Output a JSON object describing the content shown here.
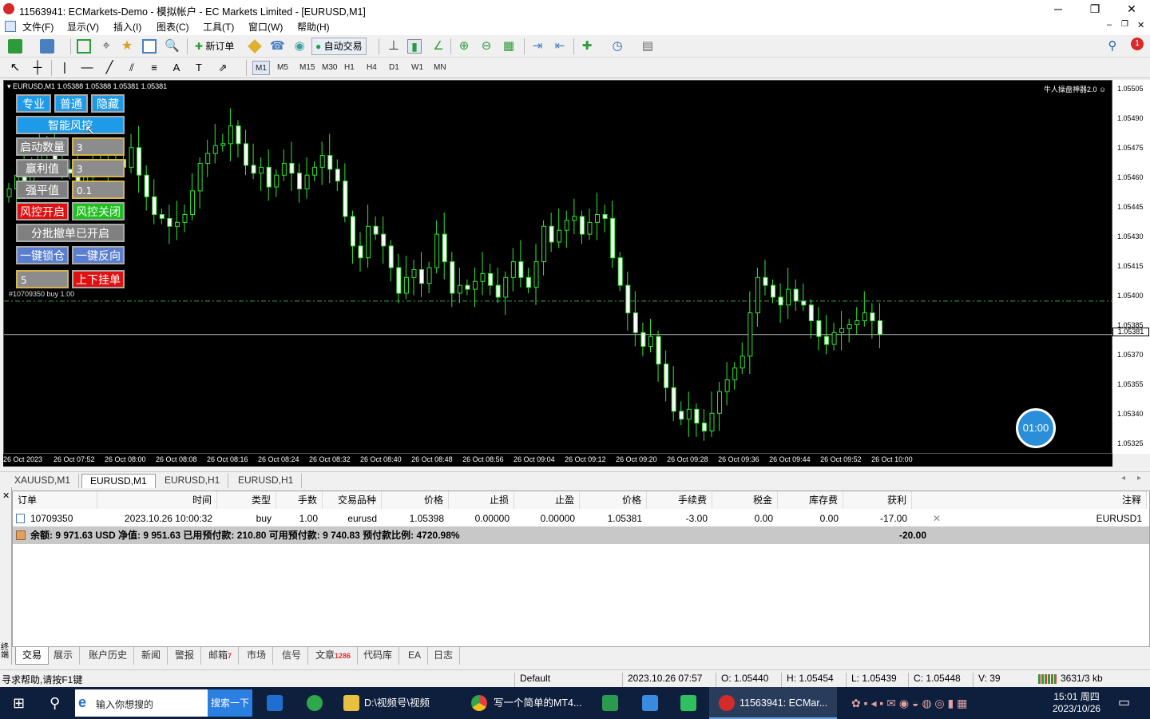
{
  "window": {
    "title": "11563941: ECMarkets-Demo - 模拟帐户 - EC Markets Limited - [EURUSD,M1]",
    "min": "─",
    "max": "❐",
    "close": "✕"
  },
  "menu": [
    "文件(F)",
    "显示(V)",
    "插入(I)",
    "图表(C)",
    "工具(T)",
    "窗口(W)",
    "帮助(H)"
  ],
  "toolbar": {
    "new_order": "新订单",
    "auto_trading": "自动交易",
    "notification_count": "1"
  },
  "timeframes": [
    "M1",
    "M5",
    "M15",
    "M30",
    "H1",
    "H4",
    "D1",
    "W1",
    "MN"
  ],
  "active_timeframe": "M1",
  "chart": {
    "header": "EURUSD,M1  1.05388 1.05388 1.05381 1.05381",
    "ea_name": "牛人操盘神器2.0",
    "order_line_label": "#10709350 buy 1.00",
    "timer": "01:00",
    "current_price": "1.05381"
  },
  "ea_panel": {
    "pro": "专业",
    "normal": "普通",
    "hide": "隐藏",
    "smart_risk": "智能风控",
    "start_count_label": "启动数量",
    "start_count_value": "3",
    "profit_label": "赢利值",
    "profit_value": "3",
    "force_close_label": "强平值",
    "force_close_value": "0.1",
    "risk_on": "风控开启",
    "risk_off": "风控关闭",
    "batch_cancel": "分批撤单已开启",
    "lock": "一键锁仓",
    "reverse": "一键反向",
    "pending_value": "5",
    "pending_button": "上下挂单"
  },
  "chart_tabs": [
    "XAUUSD,M1",
    "EURUSD,M1",
    "EURUSD,H1",
    "EURUSD,H1"
  ],
  "active_chart_tab": "EURUSD,M1",
  "terminal": {
    "columns": [
      "订单",
      "时间",
      "类型",
      "手数",
      "交易品种",
      "价格",
      "止损",
      "止盈",
      "价格",
      "手续费",
      "税金",
      "库存费",
      "获利",
      "注释"
    ],
    "rows": [
      {
        "order": "10709350",
        "time": "2023.10.26 10:00:32",
        "type": "buy",
        "lots": "1.00",
        "symbol": "eurusd",
        "open_price": "1.05398",
        "sl": "0.00000",
        "tp": "0.00000",
        "price": "1.05381",
        "commission": "-3.00",
        "tax": "0.00",
        "swap": "0.00",
        "profit": "-17.00",
        "comment": "EURUSD1"
      }
    ],
    "summary": "余额: 9 971.63 USD  净值: 9 951.63  已用预付款: 210.80  可用预付款: 9 740.83  预付款比例: 4720.98%",
    "summary_profit": "-20.00",
    "side_label": "终端"
  },
  "terminal_tabs": [
    {
      "label": "交易",
      "badge": ""
    },
    {
      "label": "展示",
      "badge": ""
    },
    {
      "label": "账户历史",
      "badge": ""
    },
    {
      "label": "新闻",
      "badge": ""
    },
    {
      "label": "警报",
      "badge": ""
    },
    {
      "label": "邮箱",
      "badge": "7"
    },
    {
      "label": "市场",
      "badge": ""
    },
    {
      "label": "信号",
      "badge": ""
    },
    {
      "label": "文章",
      "badge": "1286"
    },
    {
      "label": "代码库",
      "badge": ""
    },
    {
      "label": "EA",
      "badge": ""
    },
    {
      "label": "日志",
      "badge": ""
    }
  ],
  "statusbar": {
    "help": "寻求帮助,请按F1键",
    "profile": "Default",
    "datetime": "2023.10.26 07:57",
    "open": "O: 1.05440",
    "high": "H: 1.05454",
    "low": "L: 1.05439",
    "close": "C: 1.05448",
    "volume": "V: 39",
    "traffic": "3631/3 kb"
  },
  "taskbar": {
    "search_placeholder": "输入你想搜的",
    "search_button": "搜索一下",
    "folder": "D:\\视频号\\视频",
    "chrome": "写一个简单的MT4...",
    "mt4": "11563941: ECMar...",
    "time": "15:01 周四",
    "date": "2023/10/26"
  },
  "chart_data": {
    "type": "candlestick",
    "symbol": "EURUSD",
    "timeframe": "M1",
    "price_ticks": [
      "1.05505",
      "1.05490",
      "1.05475",
      "1.05460",
      "1.05445",
      "1.05430",
      "1.05415",
      "1.05400",
      "1.05385",
      "1.05370",
      "1.05355",
      "1.05340",
      "1.05325"
    ],
    "time_ticks": [
      "26 Oct 2023",
      "26 Oct 07:52",
      "26 Oct 08:00",
      "26 Oct 08:08",
      "26 Oct 08:16",
      "26 Oct 08:24",
      "26 Oct 08:32",
      "26 Oct 08:40",
      "26 Oct 08:48",
      "26 Oct 08:56",
      "26 Oct 09:04",
      "26 Oct 09:12",
      "26 Oct 09:20",
      "26 Oct 09:28",
      "26 Oct 09:36",
      "26 Oct 09:44",
      "26 Oct 09:52",
      "26 Oct 10:00"
    ],
    "ylim": [
      1.0532,
      1.0551
    ],
    "close": [
      1.05455,
      1.05462,
      1.05458,
      1.05466,
      1.05474,
      1.05479,
      1.0547,
      1.05465,
      1.05463,
      1.05459,
      1.05461,
      1.05466,
      1.05467,
      1.05468,
      1.0547,
      1.05466,
      1.05476,
      1.05462,
      1.05451,
      1.05442,
      1.0544,
      1.05436,
      1.05438,
      1.05442,
      1.05454,
      1.05468,
      1.05473,
      1.05477,
      1.05478,
      1.05487,
      1.05478,
      1.05467,
      1.05463,
      1.05466,
      1.05456,
      1.05462,
      1.05468,
      1.05463,
      1.05455,
      1.05462,
      1.05466,
      1.05472,
      1.05465,
      1.05459,
      1.05441,
      1.05426,
      1.0542,
      1.05436,
      1.05432,
      1.05426,
      1.05415,
      1.05402,
      1.0541,
      1.05414,
      1.05407,
      1.05415,
      1.05432,
      1.05418,
      1.05402,
      1.05406,
      1.05404,
      1.05408,
      1.05412,
      1.05406,
      1.054,
      1.0541,
      1.05418,
      1.0541,
      1.05405,
      1.05418,
      1.05436,
      1.05428,
      1.05434,
      1.05439,
      1.05441,
      1.05432,
      1.05438,
      1.05442,
      1.0544,
      1.0542,
      1.05406,
      1.05392,
      1.05382,
      1.05375,
      1.0538,
      1.05366,
      1.05354,
      1.05342,
      1.05338,
      1.05343,
      1.05336,
      1.05332,
      1.05341,
      1.05352,
      1.05358,
      1.05364,
      1.0537,
      1.05392,
      1.0541,
      1.05406,
      1.054,
      1.05396,
      1.05404,
      1.05398,
      1.05396,
      1.05388,
      1.0538,
      1.05376,
      1.05382,
      1.05384,
      1.05386,
      1.05388,
      1.05392,
      1.05388,
      1.05381
    ]
  }
}
